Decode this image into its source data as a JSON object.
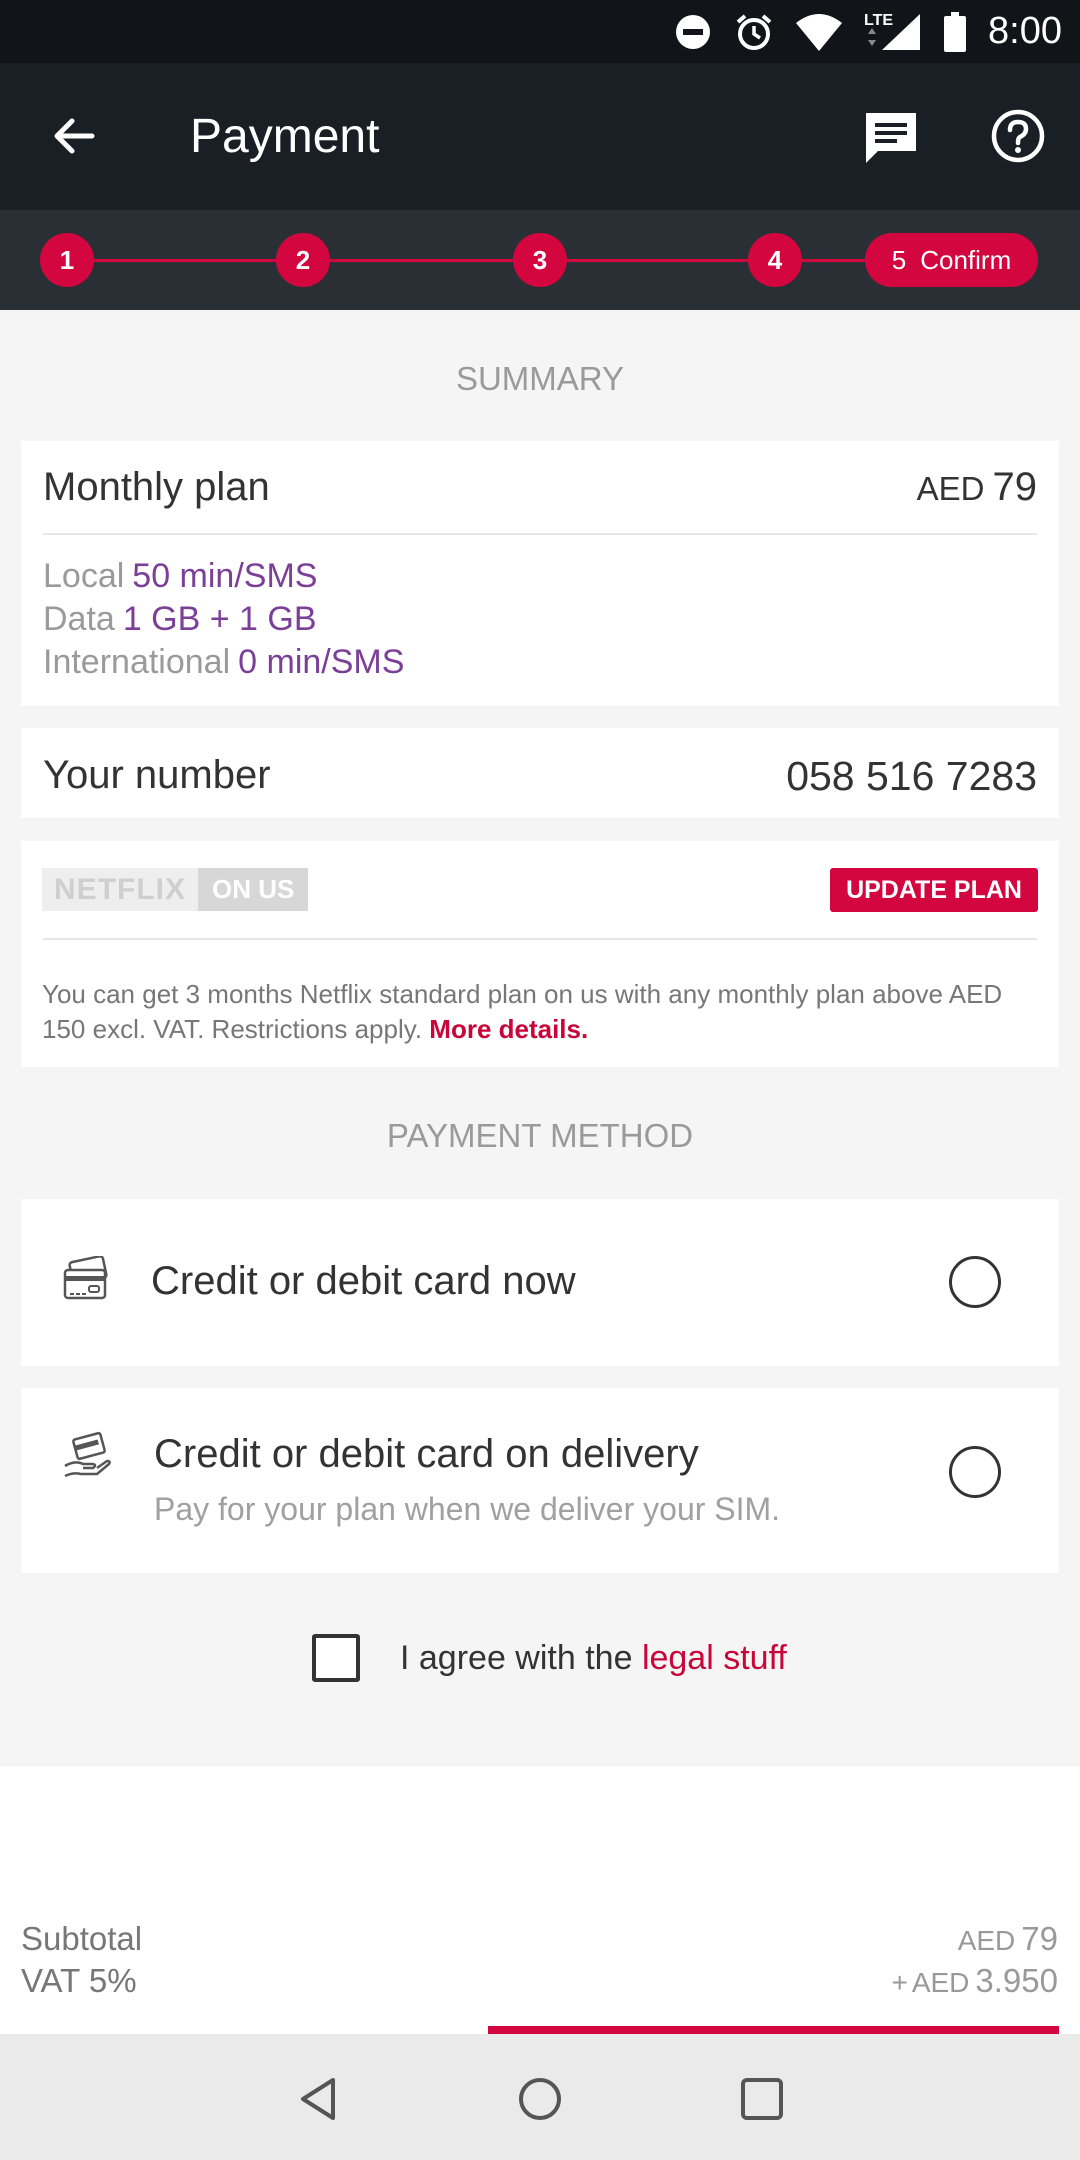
{
  "status_bar": {
    "time": "8:00",
    "network": "LTE"
  },
  "app_bar": {
    "title": "Payment"
  },
  "stepper": {
    "steps": [
      "1",
      "2",
      "3",
      "4"
    ],
    "current_number": "5",
    "current_label": "Confirm"
  },
  "summary": {
    "title": "SUMMARY",
    "plan": {
      "name": "Monthly plan",
      "currency": "AED",
      "price": "79",
      "local_label": "Local",
      "local_value": "50 min/SMS",
      "data_label": "Data",
      "data_value": "1 GB + 1 GB",
      "intl_label": "International",
      "intl_value": "0 min/SMS"
    },
    "number": {
      "label": "Your number",
      "value": "058 516 7283"
    },
    "promo": {
      "logo_word": "NETFLIX",
      "logo_tag": "ON US",
      "button": "UPDATE PLAN",
      "text": "You can get 3 months Netflix standard plan on us with any monthly plan above AED 150 excl. VAT. Restrictions apply.",
      "link": "More details."
    }
  },
  "payment_method": {
    "title": "PAYMENT METHOD",
    "options": [
      {
        "title": "Credit or debit card now",
        "icon": "credit-card-icon",
        "selected": false
      },
      {
        "title": "Credit or debit card on delivery",
        "subtitle": "Pay for your plan when we deliver your SIM.",
        "icon": "card-in-hand-icon",
        "selected": false
      }
    ]
  },
  "agreement": {
    "text": "I agree with the",
    "link": "legal stuff",
    "checked": false
  },
  "totals": {
    "subtotal_label": "Subtotal",
    "subtotal_currency": "AED",
    "subtotal_value": "79",
    "vat_label": "VAT 5%",
    "vat_prefix": "+",
    "vat_currency": "AED",
    "vat_value": "3.950"
  },
  "colors": {
    "accent": "#d3063f",
    "purple": "#7b3f98",
    "dark": "#1a1f26"
  }
}
